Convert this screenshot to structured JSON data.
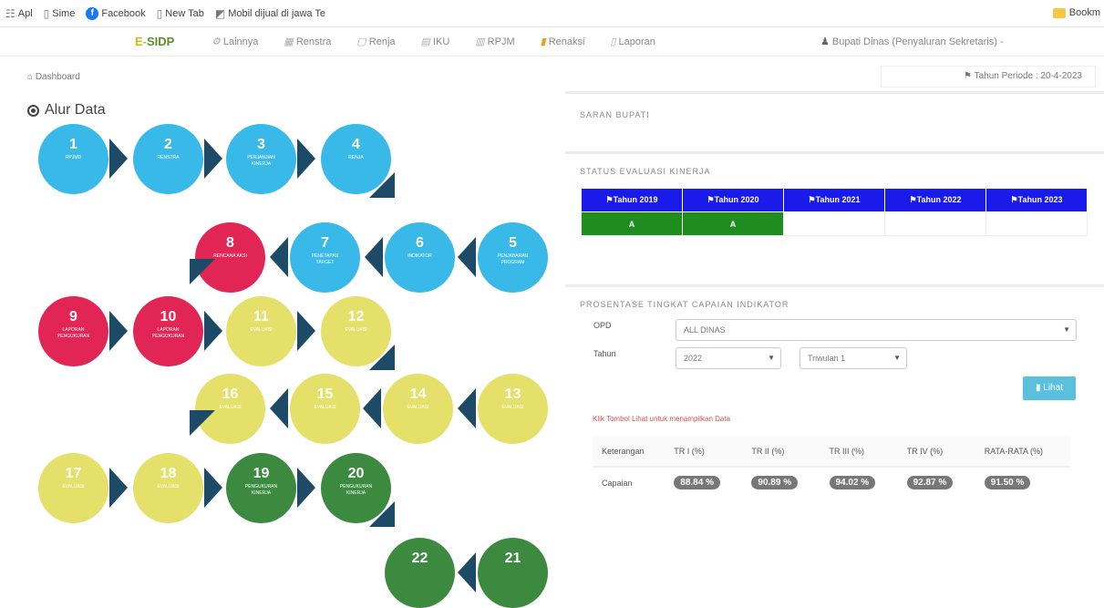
{
  "bookmarks": {
    "apps": "Apl",
    "items": [
      "Sime",
      "Facebook",
      "New Tab",
      "Mobil dijual di jawa Te"
    ],
    "right": "Bookm"
  },
  "nav": {
    "logo_a": "E-",
    "logo_b": "SIDP",
    "menu": [
      "Lainnya",
      "Renstra",
      "Renja",
      "IKU",
      "RPJM",
      "Renaksi",
      "Laporan"
    ],
    "user": "Bupati Dinas (Penyaluran Sekretaris) -"
  },
  "breadcrumb": "Dashboard",
  "date_label": "Tahun Periode : 20-4-2023",
  "alur_title": "Alur Data",
  "nodes": [
    {
      "num": "1",
      "label": "RPJMD",
      "color": "blue"
    },
    {
      "num": "2",
      "label": "RENSTRA",
      "color": "blue"
    },
    {
      "num": "3",
      "label": "PERJANJIAN KINERJA",
      "color": "blue"
    },
    {
      "num": "4",
      "label": "RENJA",
      "color": "blue"
    },
    {
      "num": "5",
      "label": "PENJABARAN PROGRAM",
      "color": "blue"
    },
    {
      "num": "6",
      "label": "INDIKATOR",
      "color": "blue"
    },
    {
      "num": "7",
      "label": "PENETAPAN TARGET",
      "color": "blue"
    },
    {
      "num": "8",
      "label": "RENCANA AKSI",
      "color": "red"
    },
    {
      "num": "9",
      "label": "LAPORAN PENGUKURAN",
      "color": "red"
    },
    {
      "num": "10",
      "label": "LAPORAN PENGUKURAN",
      "color": "red"
    },
    {
      "num": "11",
      "label": "EVALUASI",
      "color": "yel"
    },
    {
      "num": "12",
      "label": "EVALUASI",
      "color": "yel"
    },
    {
      "num": "13",
      "label": "EVALUASI",
      "color": "yel"
    },
    {
      "num": "14",
      "label": "EVALUASI",
      "color": "yel"
    },
    {
      "num": "15",
      "label": "EVALUASI",
      "color": "yel"
    },
    {
      "num": "16",
      "label": "EVALUASI",
      "color": "yel"
    },
    {
      "num": "17",
      "label": "EVALUASI",
      "color": "yel"
    },
    {
      "num": "18",
      "label": "EVALUASI",
      "color": "yel"
    },
    {
      "num": "19",
      "label": "PENGUKURAN KINERJA",
      "color": "grn"
    },
    {
      "num": "20",
      "label": "PENGUKURAN KINERJA",
      "color": "grn"
    },
    {
      "num": "21",
      "label": "",
      "color": "grn"
    },
    {
      "num": "22",
      "label": "",
      "color": "grn"
    }
  ],
  "saran": {
    "title": "SARAN BUPATI"
  },
  "status": {
    "title": "STATUS EVALUASI KINERJA",
    "headers": [
      "Tahun 2019",
      "Tahun 2020",
      "Tahun 2021",
      "Tahun 2022",
      "Tahun 2023"
    ],
    "values": [
      "A",
      "A",
      "",
      "",
      ""
    ]
  },
  "capaian": {
    "title": "PROSENTASE TINGKAT CAPAIAN INDIKATOR",
    "opd_label": "OPD",
    "opd_value": "ALL DINAS",
    "tahun_label": "Tahun",
    "tahun_value": "2022",
    "triwulan_value": "Triwulan 1",
    "lihat": "Lihat",
    "note": "Klik Tombol Lihat untuk menampilkan Data",
    "headers": [
      "Keterangan",
      "TR I (%)",
      "TR II (%)",
      "TR III (%)",
      "TR IV (%)",
      "RATA-RATA (%)"
    ],
    "row_label": "Capaian",
    "row_values": [
      "88.84 %",
      "90.89 %",
      "94.02 %",
      "92.87 %",
      "91.50 %"
    ]
  }
}
